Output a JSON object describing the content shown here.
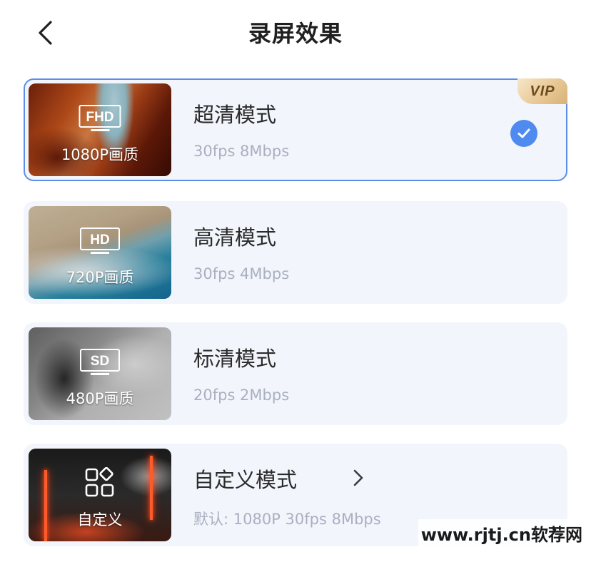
{
  "header": {
    "title": "录屏效果",
    "back_icon": "chevron-left-icon"
  },
  "modes": [
    {
      "id": "fhd",
      "badge": "FHD",
      "quality": "1080P画质",
      "title": "超清模式",
      "subtitle": "30fps 8Mbps",
      "selected": true,
      "vip": "VIP"
    },
    {
      "id": "hd",
      "badge": "HD",
      "quality": "720P画质",
      "title": "高清模式",
      "subtitle": "30fps 4Mbps",
      "selected": false
    },
    {
      "id": "sd",
      "badge": "SD",
      "quality": "480P画质",
      "title": "标清模式",
      "subtitle": "20fps 2Mbps",
      "selected": false
    },
    {
      "id": "custom",
      "quality": "自定义",
      "icon": "grid-apps-icon",
      "title": "自定义模式",
      "subtitle": "默认: 1080P 30fps 8Mbps",
      "selected": false
    }
  ],
  "watermark": "www.rjtj.cn软荐网",
  "colors": {
    "accent": "#4f8af0",
    "selected_border": "#5b8fe6",
    "card_bg": "#f2f5fb",
    "subtitle": "#a9b0c0",
    "vip_gold": "#e7c692"
  }
}
